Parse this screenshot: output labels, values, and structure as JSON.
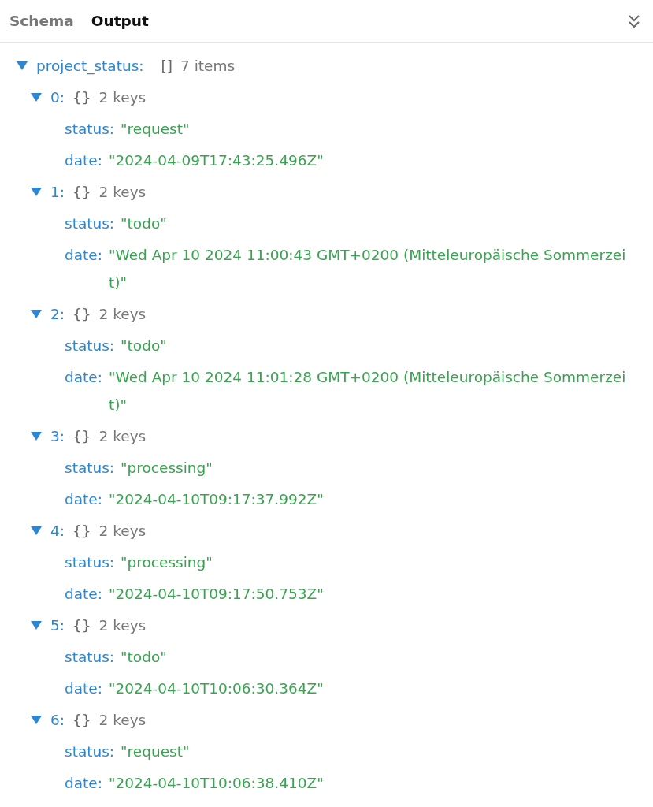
{
  "tabs": [
    {
      "label": "Schema",
      "selected": false
    },
    {
      "label": "Output",
      "selected": true
    }
  ],
  "tree": {
    "key": "project_status:",
    "type_hint": "[]",
    "summary": "7 items",
    "expanded": true,
    "children": [
      {
        "key": "0:",
        "type_hint": "{}",
        "summary": "2 keys",
        "expanded": true,
        "fields": [
          {
            "key": "status:",
            "value": "\"request\""
          },
          {
            "key": "date:",
            "value": "\"2024-04-09T17:43:25.496Z\""
          }
        ]
      },
      {
        "key": "1:",
        "type_hint": "{}",
        "summary": "2 keys",
        "expanded": true,
        "fields": [
          {
            "key": "status:",
            "value": "\"todo\""
          },
          {
            "key": "date:",
            "value": "\"Wed Apr 10 2024 11:00:43 GMT+0200 (Mitteleuropäische Sommerzeit)\""
          }
        ]
      },
      {
        "key": "2:",
        "type_hint": "{}",
        "summary": "2 keys",
        "expanded": true,
        "fields": [
          {
            "key": "status:",
            "value": "\"todo\""
          },
          {
            "key": "date:",
            "value": "\"Wed Apr 10 2024 11:01:28 GMT+0200 (Mitteleuropäische Sommerzeit)\""
          }
        ]
      },
      {
        "key": "3:",
        "type_hint": "{}",
        "summary": "2 keys",
        "expanded": true,
        "fields": [
          {
            "key": "status:",
            "value": "\"processing\""
          },
          {
            "key": "date:",
            "value": "\"2024-04-10T09:17:37.992Z\""
          }
        ]
      },
      {
        "key": "4:",
        "type_hint": "{}",
        "summary": "2 keys",
        "expanded": true,
        "fields": [
          {
            "key": "status:",
            "value": "\"processing\""
          },
          {
            "key": "date:",
            "value": "\"2024-04-10T09:17:50.753Z\""
          }
        ]
      },
      {
        "key": "5:",
        "type_hint": "{}",
        "summary": "2 keys",
        "expanded": true,
        "fields": [
          {
            "key": "status:",
            "value": "\"todo\""
          },
          {
            "key": "date:",
            "value": "\"2024-04-10T10:06:30.364Z\""
          }
        ]
      },
      {
        "key": "6:",
        "type_hint": "{}",
        "summary": "2 keys",
        "expanded": true,
        "fields": [
          {
            "key": "status:",
            "value": "\"request\""
          },
          {
            "key": "date:",
            "value": "\"2024-04-10T10:06:38.410Z\""
          }
        ]
      }
    ]
  }
}
